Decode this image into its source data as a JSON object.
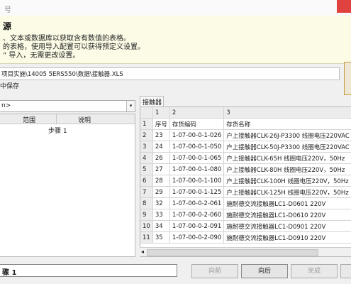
{
  "window": {
    "title": "号"
  },
  "info": {
    "heading": "源",
    "lines": [
      "、文本或数据库以获取含有数值的表格。",
      "的表格，使用导入配置可以获得预定义设置。",
      "” 导入，无需更改设置。"
    ]
  },
  "file": {
    "path": "项目实施\\14005 5ERS550\\数据\\接触器.XLS",
    "save_label": "中保存"
  },
  "left": {
    "combo_value": "n>",
    "columns": [
      "范围",
      "说明"
    ],
    "rows": [
      {
        "range": "步骤 1",
        "desc": ""
      }
    ]
  },
  "sheet": {
    "tab": "接触器",
    "col_headers": [
      "",
      "1",
      "2",
      "3"
    ],
    "rows": [
      [
        "1",
        "序号",
        "存货编码",
        "存货名称"
      ],
      [
        "2",
        "23",
        "1-07-00-0-1-026",
        "户上接触器CLK-26J-P3300  线圈电压220VAC"
      ],
      [
        "3",
        "24",
        "1-07-00-0-1-050",
        "户上接触器CLK-50J-P3300  线圈电压220VAC"
      ],
      [
        "4",
        "26",
        "1-07-00-0-1-065",
        "户上接触器CLK-65H      线圈电压220V，50Hz"
      ],
      [
        "5",
        "27",
        "1-07-00-0-1-080",
        "户上接触器CLK-80H      线圈电压220V，50Hz"
      ],
      [
        "6",
        "28",
        "1-07-00-0-1-100",
        "户上接触器CLK-100H     线圈电压220V，50Hz"
      ],
      [
        "7",
        "29",
        "1-07-00-0-1-125",
        "户上接触器CLK-125H     线圈电压220V，50Hz"
      ],
      [
        "8",
        "32",
        "1-07-00-0-2-061",
        "施耐德交流接触器LC1-D0601 220V"
      ],
      [
        "9",
        "33",
        "1-07-00-0-2-060",
        "施耐德交流接触器LC1-D0610 220V"
      ],
      [
        "10",
        "34",
        "1-07-00-0-2-091",
        "施耐德交流接触器LC1-D0901 220V"
      ],
      [
        "11",
        "35",
        "1-07-00-0-2-090",
        "施耐德交流接触器LC1-D0910 220V"
      ]
    ]
  },
  "footer": {
    "step": "骤 1",
    "prev": "向前",
    "next": "向后",
    "finish": "完成"
  }
}
